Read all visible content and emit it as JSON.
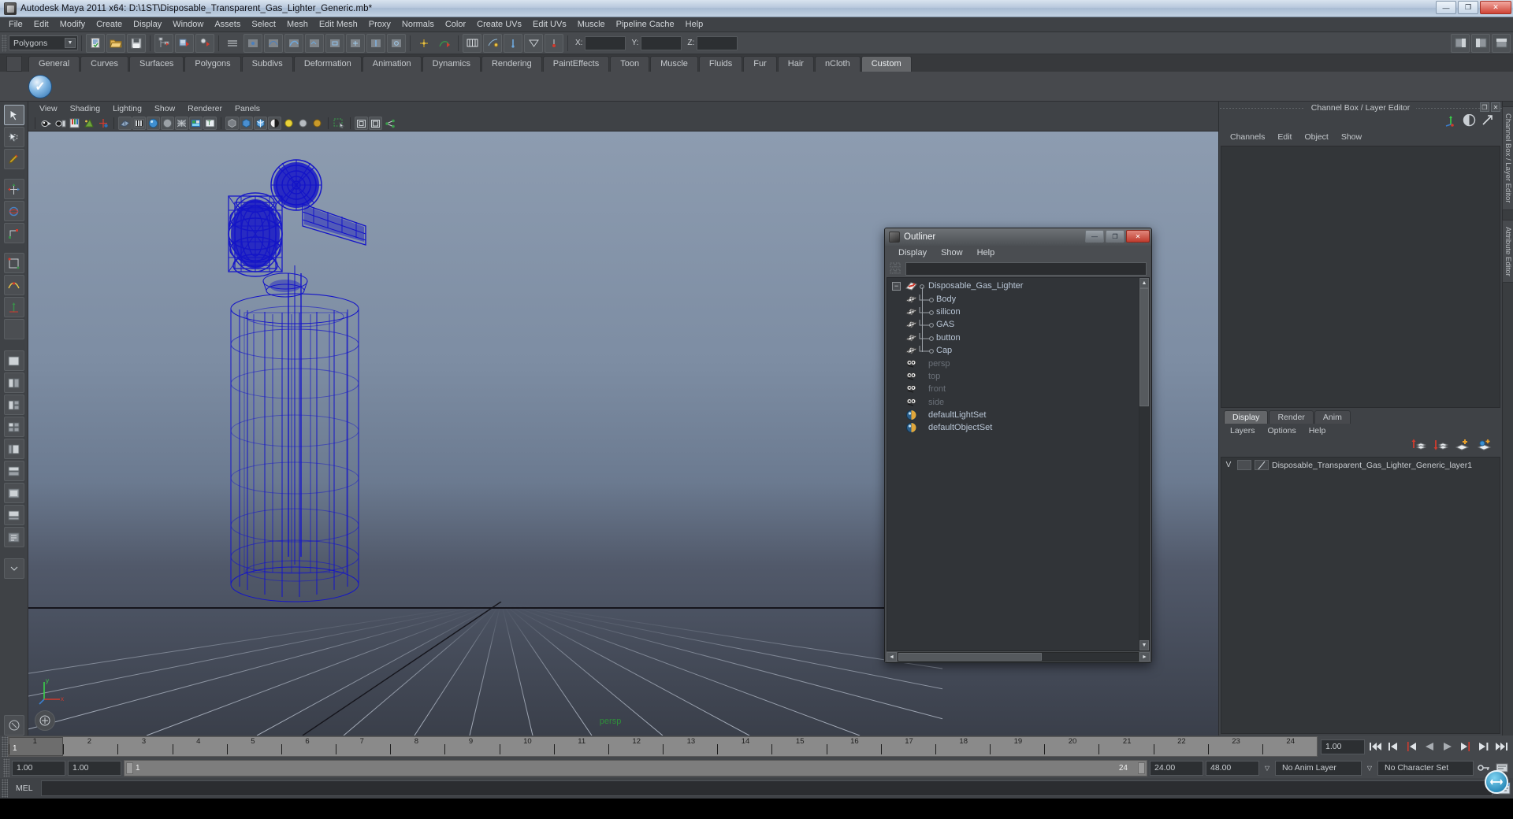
{
  "window": {
    "title": "Autodesk Maya 2011 x64: D:\\1ST\\Disposable_Transparent_Gas_Lighter_Generic.mb*",
    "minimize": "—",
    "maximize": "❐",
    "close": "✕"
  },
  "menubar": {
    "items": [
      "File",
      "Edit",
      "Modify",
      "Create",
      "Display",
      "Window",
      "Assets",
      "Select",
      "Mesh",
      "Edit Mesh",
      "Proxy",
      "Normals",
      "Color",
      "Create UVs",
      "Edit UVs",
      "Muscle",
      "Pipeline Cache",
      "Help"
    ]
  },
  "statusline": {
    "menu_set": "Polygons",
    "menu_set_arrow": "▼",
    "x_label": "X:",
    "y_label": "Y:",
    "z_label": "Z:",
    "x_value": "",
    "y_value": "",
    "z_value": ""
  },
  "shelf": {
    "tabs": [
      "General",
      "Curves",
      "Surfaces",
      "Polygons",
      "Subdivs",
      "Deformation",
      "Animation",
      "Dynamics",
      "Rendering",
      "PaintEffects",
      "Toon",
      "Muscle",
      "Fluids",
      "Fur",
      "Hair",
      "nCloth",
      "Custom"
    ],
    "active_tab": "Custom"
  },
  "viewport": {
    "menus": [
      "View",
      "Shading",
      "Lighting",
      "Show",
      "Renderer",
      "Panels"
    ],
    "camera_label": "persp"
  },
  "outliner": {
    "title": "Outliner",
    "min_btn": "—",
    "max_btn": "❐",
    "close_btn": "✕",
    "menus": [
      "Display",
      "Show",
      "Help"
    ],
    "search_value": "",
    "search_placeholder": "",
    "scroll_up": "▲",
    "scroll_down": "▼",
    "scroll_left": "◄",
    "scroll_right": "►",
    "expand_glyph": "−",
    "items": [
      {
        "label": "Disposable_Gas_Lighter",
        "type": "group",
        "depth": 0,
        "dim": false
      },
      {
        "label": "Body",
        "type": "mesh",
        "depth": 1,
        "dim": false
      },
      {
        "label": "silicon",
        "type": "mesh",
        "depth": 1,
        "dim": false
      },
      {
        "label": "GAS",
        "type": "mesh",
        "depth": 1,
        "dim": false
      },
      {
        "label": "button",
        "type": "mesh",
        "depth": 1,
        "dim": false
      },
      {
        "label": "Cap",
        "type": "mesh",
        "depth": 1,
        "dim": false
      },
      {
        "label": "persp",
        "type": "camera",
        "depth": 0,
        "dim": true
      },
      {
        "label": "top",
        "type": "camera",
        "depth": 0,
        "dim": true
      },
      {
        "label": "front",
        "type": "camera",
        "depth": 0,
        "dim": true
      },
      {
        "label": "side",
        "type": "camera",
        "depth": 0,
        "dim": true
      },
      {
        "label": "defaultLightSet",
        "type": "set",
        "depth": 0,
        "dim": false
      },
      {
        "label": "defaultObjectSet",
        "type": "set",
        "depth": 0,
        "dim": false
      }
    ]
  },
  "channelbox": {
    "panel_title": "Channel Box / Layer Editor",
    "undock_btn": "❐",
    "close_btn": "✕",
    "menus": [
      "Channels",
      "Edit",
      "Object",
      "Show"
    ],
    "dock_tabs": [
      "Channel Box / Layer Editor",
      "Attribute Editor"
    ]
  },
  "layer_editor": {
    "tabs": [
      "Display",
      "Render",
      "Anim"
    ],
    "active_tab": "Display",
    "menus": [
      "Layers",
      "Options",
      "Help"
    ],
    "layers": [
      {
        "visibility": "V",
        "playback": "",
        "name": "Disposable_Transparent_Gas_Lighter_Generic_layer1"
      }
    ]
  },
  "timeslider": {
    "ticks": [
      "1",
      "2",
      "3",
      "4",
      "5",
      "6",
      "7",
      "8",
      "9",
      "10",
      "11",
      "12",
      "13",
      "14",
      "15",
      "16",
      "17",
      "18",
      "19",
      "20",
      "21",
      "22",
      "23",
      "24"
    ],
    "current_frame": "1",
    "current_field": "1.00",
    "playback_buttons": [
      "|◀◀",
      "|◀",
      "▮◀",
      "◀",
      "▶",
      "▶▮",
      "▶|",
      "▶▶|"
    ]
  },
  "range": {
    "anim_start": "1.00",
    "range_start": "1.00",
    "bar_start": "1",
    "bar_end": "24",
    "range_end": "24.00",
    "anim_end": "48.00",
    "anim_layer": "No Anim Layer",
    "character_set": "No Character Set",
    "dropdown_glyph": "▽"
  },
  "mel": {
    "label": "MEL",
    "command_value": ""
  },
  "statusbar": {
    "message": ""
  },
  "colors": {
    "wireframe_blue": "#1414c8",
    "grid": "#9aa2ad",
    "persp_green": "#2f8f3a",
    "accent_red": "#cf4436"
  }
}
